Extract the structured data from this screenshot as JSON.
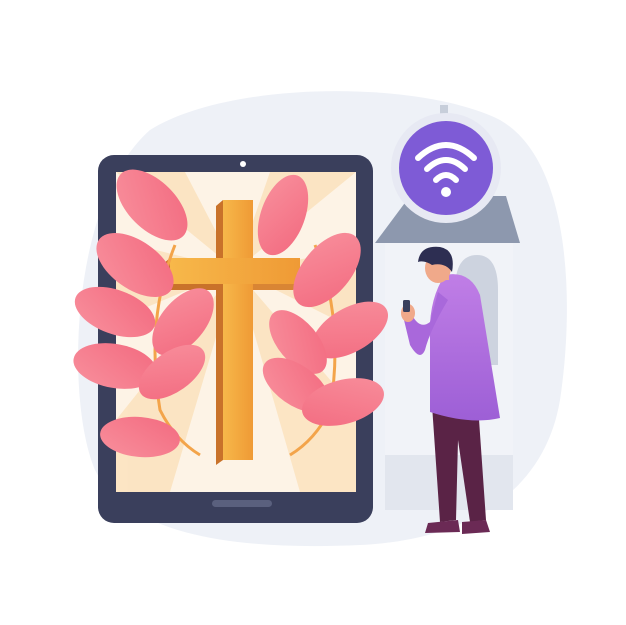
{
  "illustration": {
    "subject": "online-worship",
    "elements": [
      "tablet",
      "cross",
      "laurel-branches",
      "wifi-badge",
      "chapel",
      "praying-man"
    ],
    "icons": [
      "wifi-icon",
      "cross-icon"
    ],
    "colors": {
      "background": "#ffffff",
      "blob": "#eef1f7",
      "tablet_frame": "#3a3f5c",
      "tablet_screen": "#fdf3e6",
      "cross_front": "#f5b043",
      "cross_side": "#c9722a",
      "leaf": "#f6788a",
      "wifi_badge": "#7e5bd6",
      "chapel_roof": "#8d98ae",
      "chapel_wall": "#f1f3f8",
      "shirt": "#b775e0",
      "pants": "#5a2346",
      "hair": "#2d2e52",
      "skin": "#f0a98a"
    }
  }
}
